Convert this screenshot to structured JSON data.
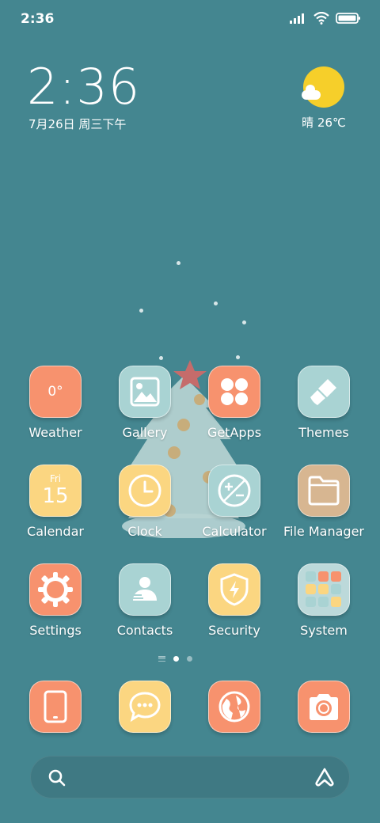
{
  "status_bar": {
    "time": "2:36",
    "icons": [
      "signal-icon",
      "wifi-icon",
      "battery-icon"
    ]
  },
  "clock_widget": {
    "time": "2:36",
    "date": "7月26日 周三下午"
  },
  "weather_widget": {
    "condition_icon": "sun-cloud-icon",
    "text": "晴 26℃"
  },
  "apps": [
    {
      "label": "Weather",
      "icon": "weather-icon",
      "icon_text": "0°",
      "color": "#f7926e"
    },
    {
      "label": "Gallery",
      "icon": "gallery-icon",
      "color": "#a9d3d3"
    },
    {
      "label": "GetApps",
      "icon": "getapps-icon",
      "color": "#f7926e"
    },
    {
      "label": "Themes",
      "icon": "brush-icon",
      "color": "#a9d3d3"
    },
    {
      "label": "Calendar",
      "icon": "calendar-icon",
      "icon_day": "Fri",
      "icon_date": "15",
      "color": "#fbd681"
    },
    {
      "label": "Clock",
      "icon": "clock-icon",
      "color": "#fbd681"
    },
    {
      "label": "Calculator",
      "icon": "calculator-icon",
      "color": "#a9d3d3"
    },
    {
      "label": "File Manager",
      "icon": "folder-icon",
      "color": "#d7b691"
    },
    {
      "label": "Settings",
      "icon": "gear-icon",
      "color": "#f7926e"
    },
    {
      "label": "Contacts",
      "icon": "contact-icon",
      "color": "#a9d3d3"
    },
    {
      "label": "Security",
      "icon": "shield-icon",
      "color": "#fbd681"
    },
    {
      "label": "System",
      "icon": "folder-grid-icon",
      "color": "#a9d3d3"
    }
  ],
  "dock": [
    {
      "icon": "phone-icon",
      "color": "#f7926e"
    },
    {
      "icon": "messaging-icon",
      "color": "#fbd681"
    },
    {
      "icon": "browser-icon",
      "color": "#f7926e"
    },
    {
      "icon": "camera-icon",
      "color": "#f7926e"
    }
  ],
  "page_indicator": {
    "pages": 2,
    "active": 1
  },
  "search_bar": {
    "left_icon": "search-icon",
    "right_icon": "assistant-icon"
  },
  "colors": {
    "wallpaper": "#448690",
    "orange": "#f7926e",
    "teal": "#a9d3d3",
    "yellow": "#fbd681",
    "tan": "#d7b691"
  }
}
